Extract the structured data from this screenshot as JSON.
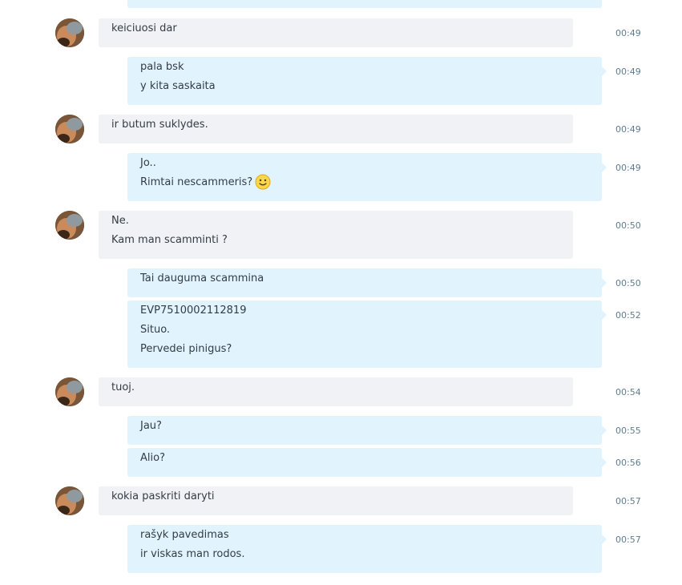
{
  "messages": [
    {
      "side": "in",
      "avatar": true,
      "time": "00:49",
      "lines": [
        "keiciuosi dar"
      ]
    },
    {
      "side": "out",
      "avatar": false,
      "time": "00:49",
      "lines": [
        "pala bsk",
        "y kita saskaita"
      ]
    },
    {
      "side": "in",
      "avatar": true,
      "time": "00:49",
      "lines": [
        "ir butum suklydes."
      ]
    },
    {
      "side": "out",
      "avatar": false,
      "time": "00:49",
      "lines": [
        "Jo..",
        "Rimtai nescammeris?"
      ],
      "emoji_after_line": 1,
      "emoji": "smiley-emoji-icon"
    },
    {
      "side": "in",
      "avatar": true,
      "time": "00:50",
      "lines": [
        "Ne.",
        "Kam man scamminti ?"
      ]
    },
    {
      "side": "out",
      "avatar": false,
      "time": "00:50",
      "lines": [
        "Tai dauguma scammina"
      ]
    },
    {
      "side": "out",
      "avatar": false,
      "time": "00:52",
      "lines": [
        "EVP7510002112819",
        "Situo.",
        "Pervedei pinigus?"
      ]
    },
    {
      "side": "in",
      "avatar": true,
      "time": "00:54",
      "lines": [
        "tuoj."
      ]
    },
    {
      "side": "out",
      "avatar": false,
      "time": "00:55",
      "lines": [
        "Jau?"
      ]
    },
    {
      "side": "out",
      "avatar": false,
      "time": "00:56",
      "lines": [
        "Alio?"
      ]
    },
    {
      "side": "in",
      "avatar": true,
      "time": "00:57",
      "lines": [
        "kokia paskriti daryti"
      ]
    },
    {
      "side": "out",
      "avatar": false,
      "time": "00:57",
      "lines": [
        "rašyk pavedimas",
        "ir viskas man rodos."
      ]
    }
  ],
  "colors": {
    "incoming_bubble": "#f1f2f6",
    "outgoing_bubble": "#e1f3fc",
    "timestamp": "#5f7d90",
    "text": "#333c45"
  }
}
